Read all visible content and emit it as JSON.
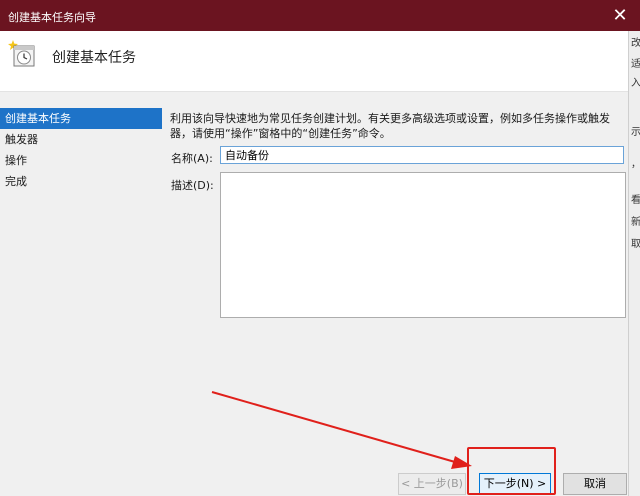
{
  "window": {
    "title": "创建基本任务向导",
    "close_glyph": "✕"
  },
  "header": {
    "title": "创建基本任务",
    "icon": "calendar-clock-icon"
  },
  "nav": {
    "items": [
      {
        "label": "创建基本任务",
        "active": true
      },
      {
        "label": "触发器",
        "active": false
      },
      {
        "label": "操作",
        "active": false
      },
      {
        "label": "完成",
        "active": false
      }
    ]
  },
  "main": {
    "description": "利用该向导快速地为常见任务创建计划。有关更多高级选项或设置，例如多任务操作或触发器，请使用“操作”窗格中的“创建任务”命令。",
    "name_label": "名称(A):",
    "name_value": "自动备份",
    "desc_label": "描述(D):",
    "desc_value": ""
  },
  "buttons": {
    "back": "< 上一步(B)",
    "next": "下一步(N) >",
    "cancel": "取消"
  },
  "background_window": {
    "chars": [
      "改",
      "适",
      "入",
      "示",
      "，",
      "看",
      "新",
      "取"
    ]
  },
  "colors": {
    "titlebar": "#6b1420",
    "accent": "#1e73c8",
    "annotation": "#e0201b"
  }
}
